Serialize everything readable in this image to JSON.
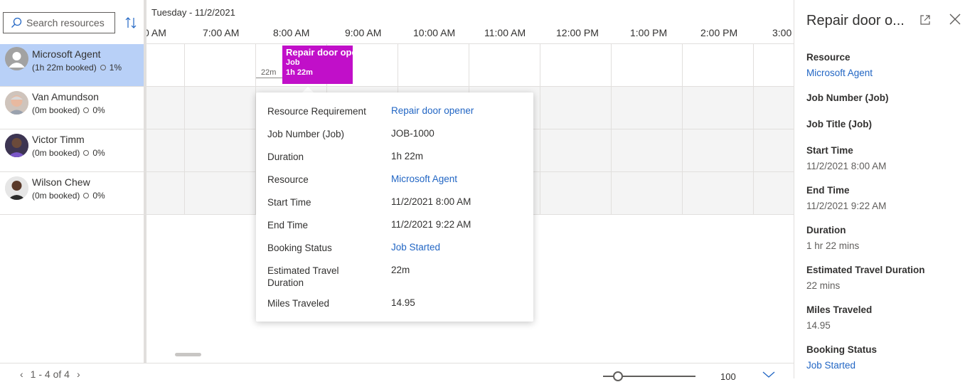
{
  "search": {
    "placeholder": "Search resources"
  },
  "resources": [
    {
      "name": "Microsoft Agent",
      "booked": "(1h 22m booked)",
      "pct": "1%"
    },
    {
      "name": "Van Amundson",
      "booked": "(0m booked)",
      "pct": "0%"
    },
    {
      "name": "Victor Timm",
      "booked": "(0m booked)",
      "pct": "0%"
    },
    {
      "name": "Wilson Chew",
      "booked": "(0m booked)",
      "pct": "0%"
    }
  ],
  "schedule": {
    "date": "Tuesday - 11/2/2021",
    "hours": [
      "0 AM",
      "7:00 AM",
      "8:00 AM",
      "9:00 AM",
      "10:00 AM",
      "11:00 AM",
      "12:00 PM",
      "1:00 PM",
      "2:00 PM",
      "3:00"
    ]
  },
  "booking": {
    "title": "Repair door opener",
    "type": "Job",
    "duration": "1h 22m",
    "travel": "22m",
    "color": "#c10fc9"
  },
  "tooltip": {
    "rows": [
      {
        "label": "Resource Requirement",
        "value": "Repair door opener"
      },
      {
        "label": "Job Number (Job)",
        "value": "JOB-1000"
      },
      {
        "label": "Duration",
        "value": "1h 22m"
      },
      {
        "label": "Resource",
        "value": "Microsoft Agent"
      },
      {
        "label": "Start Time",
        "value": "11/2/2021 8:00 AM"
      },
      {
        "label": "End Time",
        "value": "11/2/2021 9:22 AM"
      },
      {
        "label": "Booking Status",
        "value": "Job Started"
      },
      {
        "label": "Estimated Travel Duration",
        "value": "22m"
      },
      {
        "label": "Miles Traveled",
        "value": "14.95"
      }
    ]
  },
  "pager": {
    "text": "1 - 4 of 4"
  },
  "zoom": {
    "value": "100"
  },
  "details": {
    "title": "Repair door o...",
    "fields": [
      {
        "label": "Resource",
        "value": "Microsoft Agent"
      },
      {
        "label": "Job Number (Job)",
        "value": ""
      },
      {
        "label": "Job Title (Job)",
        "value": ""
      },
      {
        "label": "Start Time",
        "value": "11/2/2021 8:00 AM"
      },
      {
        "label": "End Time",
        "value": "11/2/2021 9:22 AM"
      },
      {
        "label": "Duration",
        "value": "1 hr 22 mins"
      },
      {
        "label": "Estimated Travel Duration",
        "value": "22 mins"
      },
      {
        "label": "Miles Traveled",
        "value": "14.95"
      },
      {
        "label": "Booking Status",
        "value": "Job Started"
      }
    ]
  }
}
